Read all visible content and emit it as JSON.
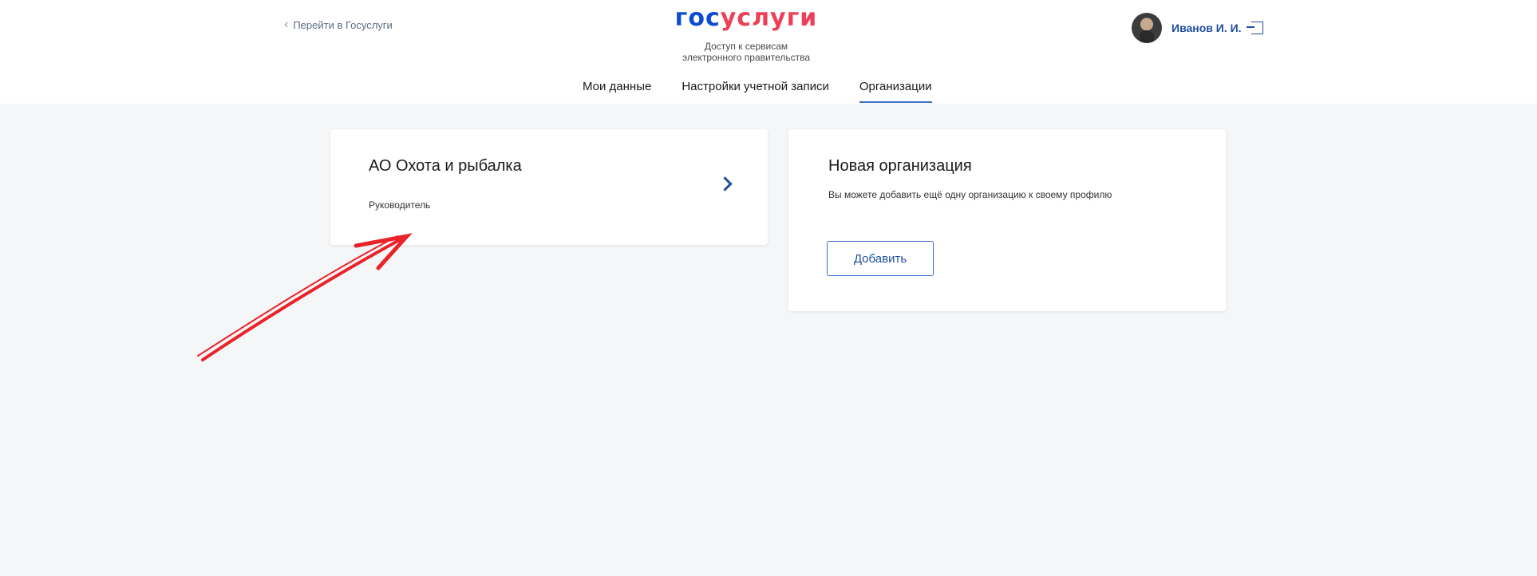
{
  "header": {
    "back_link": "Перейти в Госуслуги",
    "logo_part1": "гос",
    "logo_part2": "услуги",
    "tagline_line1": "Доступ к сервисам",
    "tagline_line2": "электронного правительства",
    "user_name": "Иванов И. И."
  },
  "tabs": [
    {
      "label": "Мои данные",
      "active": false
    },
    {
      "label": "Настройки учетной записи",
      "active": false
    },
    {
      "label": "Организации",
      "active": true
    }
  ],
  "org_card": {
    "title": "АО Охота и рыбалка",
    "role": "Руководитель"
  },
  "new_org_card": {
    "title": "Новая организация",
    "description": "Вы можете добавить ещё одну организацию к своему профилю",
    "add_button": "Добавить"
  },
  "colors": {
    "brand_blue": "#0d4cd3",
    "brand_red": "#ee3f58",
    "link_blue": "#1f4fa0",
    "annotation_red": "#e8232a",
    "page_bg": "#f5f6f7"
  },
  "icons": {
    "back": "chevron-left-icon",
    "logout": "logout-icon",
    "open_org": "chevron-right-icon",
    "annotation": "red-arrow-icon"
  }
}
